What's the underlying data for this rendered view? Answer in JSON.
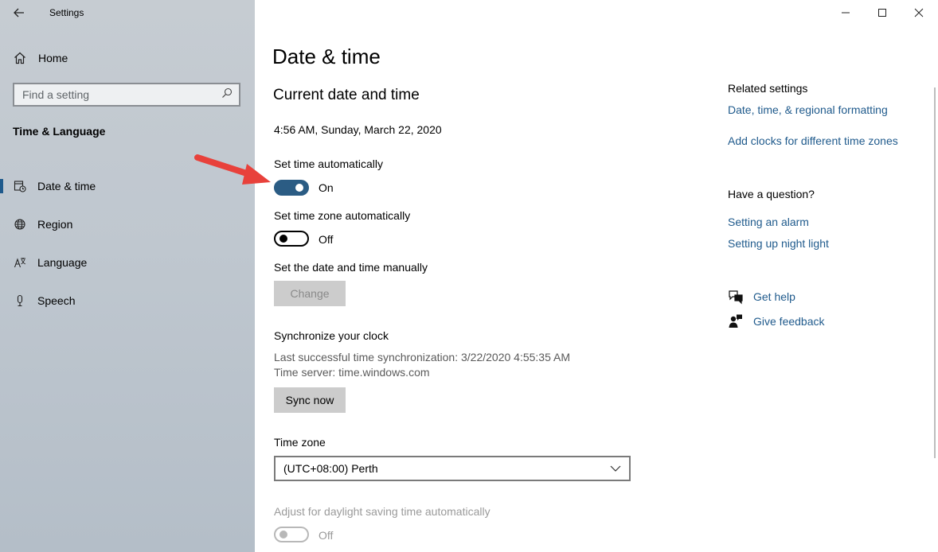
{
  "window": {
    "app_title": "Settings",
    "controls": {
      "minimize": "minimize-icon",
      "maximize": "maximize-icon",
      "close": "close-icon"
    }
  },
  "sidebar": {
    "home_label": "Home",
    "search": {
      "placeholder": "Find a setting",
      "value": ""
    },
    "section_title": "Time & Language",
    "items": [
      {
        "label": "Date & time",
        "icon": "calendar-clock-icon",
        "active": true
      },
      {
        "label": "Region",
        "icon": "globe-icon",
        "active": false
      },
      {
        "label": "Language",
        "icon": "language-icon",
        "active": false
      },
      {
        "label": "Speech",
        "icon": "microphone-icon",
        "active": false
      }
    ]
  },
  "main": {
    "title": "Date & time",
    "section_title": "Current date and time",
    "current_datetime": "4:56 AM, Sunday, March 22, 2020",
    "set_time_auto": {
      "label": "Set time automatically",
      "state": "On",
      "on": true
    },
    "set_zone_auto": {
      "label": "Set time zone automatically",
      "state": "Off",
      "on": false
    },
    "manual": {
      "label": "Set the date and time manually",
      "button": "Change"
    },
    "sync": {
      "title": "Synchronize your clock",
      "last_sync": "Last successful time synchronization: 3/22/2020 4:55:35 AM",
      "server": "Time server: time.windows.com",
      "button": "Sync now"
    },
    "time_zone": {
      "label": "Time zone",
      "value": "(UTC+08:00) Perth"
    },
    "dst": {
      "label": "Adjust for daylight saving time automatically",
      "state": "Off",
      "on": false,
      "disabled": true
    }
  },
  "related": {
    "title": "Related settings",
    "links": [
      "Date, time, & regional formatting",
      "Add clocks for different time zones"
    ],
    "question_title": "Have a question?",
    "question_links": [
      "Setting an alarm",
      "Setting up night light"
    ],
    "help": "Get help",
    "feedback": "Give feedback"
  },
  "colors": {
    "accent": "#2b5c84",
    "link": "#1f5a8c",
    "annotation_arrow": "#e8413b"
  }
}
